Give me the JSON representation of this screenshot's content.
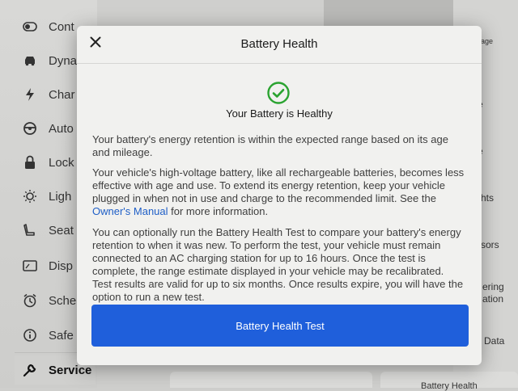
{
  "background": {
    "sidebar": {
      "items": [
        {
          "label": "Cont",
          "icon": "toggle-icon"
        },
        {
          "label": "Dyna",
          "icon": "car-icon"
        },
        {
          "label": "Char",
          "icon": "bolt-icon"
        },
        {
          "label": "Auto",
          "icon": "steering-wheel-icon"
        },
        {
          "label": "Lock",
          "icon": "lock-icon"
        },
        {
          "label": "Ligh",
          "icon": "light-icon"
        },
        {
          "label": "Seat",
          "icon": "seat-icon"
        },
        {
          "label": "Disp",
          "icon": "display-icon"
        },
        {
          "label": "Sche",
          "icon": "clock-icon"
        },
        {
          "label": "Safe",
          "icon": "info-icon"
        },
        {
          "label": "Service",
          "icon": "wrench-icon",
          "active": true
        }
      ]
    },
    "right_panel": {
      "items": [
        "age",
        "e",
        "e",
        "hts",
        "sors",
        "ering",
        "ation",
        "Data",
        "Battery Health"
      ]
    }
  },
  "modal": {
    "title": "Battery Health",
    "close_icon": "close-icon",
    "status_icon": "check-circle-icon",
    "status_color": "#2aa330",
    "status_title": "Your Battery is Healthy",
    "paragraph1": "Your battery's energy retention is within the expected range based on its age and mileage.",
    "paragraph2_before": "Your vehicle's high-voltage battery, like all rechargeable batteries, becomes less effective with age and use. To extend its energy retention, keep your vehicle plugged in when not in use and charge to the recommended limit. See the ",
    "paragraph2_link": "Owner's Manual",
    "paragraph2_after": " for more information.",
    "paragraph3": "You can optionally run the Battery Health Test to compare your battery's energy retention to when it was new. To perform the test, your vehicle must remain connected to an AC charging station for up to 16 hours. Once the test is complete, the range estimate displayed in your vehicle may be recalibrated. Test results are valid for up to six months. Once results expire, you will have the option to run a new test.",
    "button_label": "Battery Health Test",
    "button_color": "#1f5fdb"
  }
}
